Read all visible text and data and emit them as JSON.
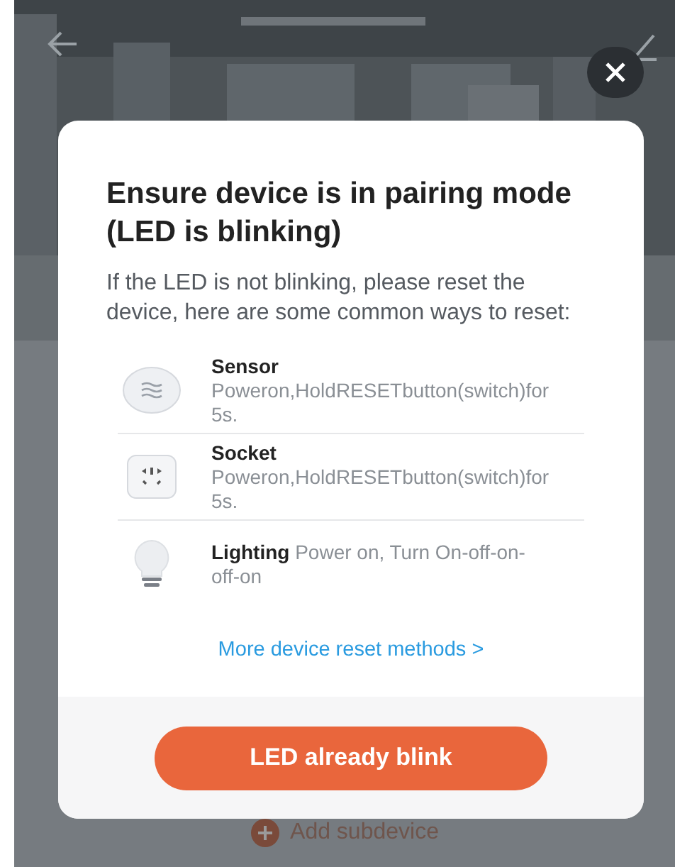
{
  "background": {
    "add_subdevice": "Add subdevice"
  },
  "dialog": {
    "title": "Ensure device is in pairing mode (LED is blinking)",
    "description": "If the LED is not blinking, please reset the device, here are some common ways to reset:",
    "methods": [
      {
        "kind": "sensor",
        "name": "Sensor",
        "instruction": "Poweron,HoldRESETbutton(switch)for5s."
      },
      {
        "kind": "socket",
        "name": "Socket",
        "instruction": "Poweron,HoldRESETbutton(switch)for5s."
      },
      {
        "kind": "lighting",
        "name": "Lighting",
        "instruction": "Power on, Turn On-off-on-off-on"
      }
    ],
    "more_link": "More device reset methods >",
    "confirm_button": "LED already blink"
  }
}
